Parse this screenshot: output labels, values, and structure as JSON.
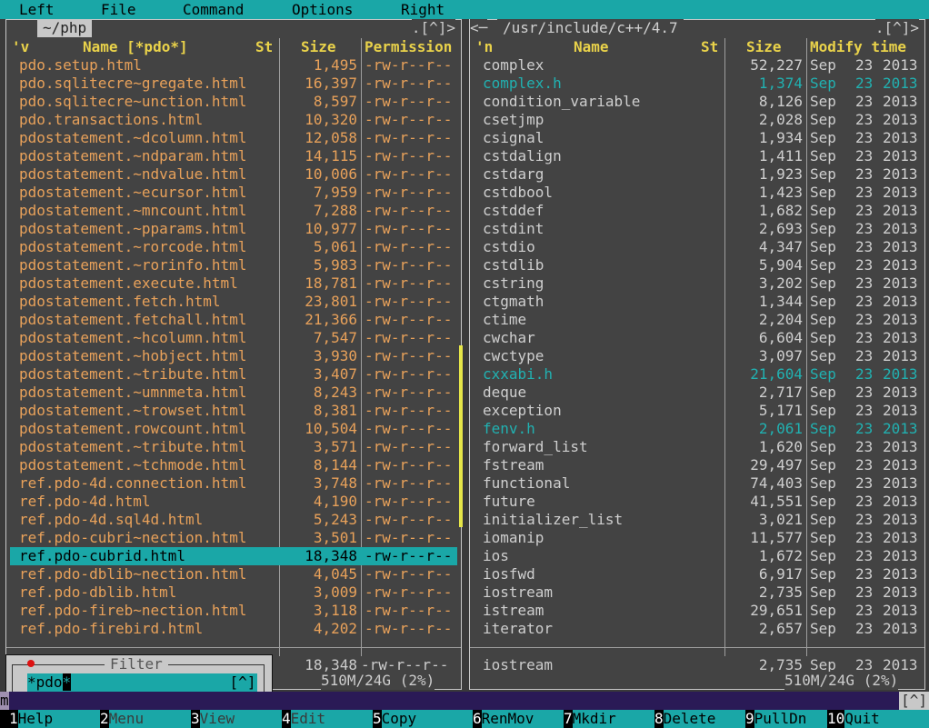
{
  "menubar": {
    "items": [
      "Left",
      "File",
      "Command",
      "Options",
      "Right"
    ]
  },
  "left_panel": {
    "title": "~/php",
    "corner": ".[^]>",
    "headers": {
      "sort": "'v",
      "name": "Name [*pdo*]",
      "st": "St",
      "size": "Size",
      "perm": "Permission"
    },
    "files": [
      {
        "name": "pdo.setup.html",
        "size": "1,495",
        "perm": "-rw-r--r--"
      },
      {
        "name": "pdo.sqlitecre~gregate.html",
        "size": "16,397",
        "perm": "-rw-r--r--"
      },
      {
        "name": "pdo.sqlitecre~unction.html",
        "size": "8,597",
        "perm": "-rw-r--r--"
      },
      {
        "name": "pdo.transactions.html",
        "size": "10,320",
        "perm": "-rw-r--r--"
      },
      {
        "name": "pdostatement.~dcolumn.html",
        "size": "12,058",
        "perm": "-rw-r--r--"
      },
      {
        "name": "pdostatement.~ndparam.html",
        "size": "14,115",
        "perm": "-rw-r--r--"
      },
      {
        "name": "pdostatement.~ndvalue.html",
        "size": "10,006",
        "perm": "-rw-r--r--"
      },
      {
        "name": "pdostatement.~ecursor.html",
        "size": "7,959",
        "perm": "-rw-r--r--"
      },
      {
        "name": "pdostatement.~mncount.html",
        "size": "7,288",
        "perm": "-rw-r--r--"
      },
      {
        "name": "pdostatement.~pparams.html",
        "size": "10,977",
        "perm": "-rw-r--r--"
      },
      {
        "name": "pdostatement.~rorcode.html",
        "size": "5,061",
        "perm": "-rw-r--r--"
      },
      {
        "name": "pdostatement.~rorinfo.html",
        "size": "5,983",
        "perm": "-rw-r--r--"
      },
      {
        "name": "pdostatement.execute.html",
        "size": "18,781",
        "perm": "-rw-r--r--"
      },
      {
        "name": "pdostatement.fetch.html",
        "size": "23,801",
        "perm": "-rw-r--r--"
      },
      {
        "name": "pdostatement.fetchall.html",
        "size": "21,366",
        "perm": "-rw-r--r--"
      },
      {
        "name": "pdostatement.~hcolumn.html",
        "size": "7,547",
        "perm": "-rw-r--r--"
      },
      {
        "name": "pdostatement.~hobject.html",
        "size": "3,930",
        "perm": "-rw-r--r--"
      },
      {
        "name": "pdostatement.~tribute.html",
        "size": "3,407",
        "perm": "-rw-r--r--"
      },
      {
        "name": "pdostatement.~umnmeta.html",
        "size": "8,243",
        "perm": "-rw-r--r--"
      },
      {
        "name": "pdostatement.~trowset.html",
        "size": "8,381",
        "perm": "-rw-r--r--"
      },
      {
        "name": "pdostatement.rowcount.html",
        "size": "10,504",
        "perm": "-rw-r--r--"
      },
      {
        "name": "pdostatement.~tribute.html",
        "size": "3,571",
        "perm": "-rw-r--r--"
      },
      {
        "name": "pdostatement.~tchmode.html",
        "size": "8,144",
        "perm": "-rw-r--r--"
      },
      {
        "name": "ref.pdo-4d.connection.html",
        "size": "3,748",
        "perm": "-rw-r--r--"
      },
      {
        "name": "ref.pdo-4d.html",
        "size": "4,190",
        "perm": "-rw-r--r--"
      },
      {
        "name": "ref.pdo-4d.sql4d.html",
        "size": "5,243",
        "perm": "-rw-r--r--"
      },
      {
        "name": "ref.pdo-cubri~nection.html",
        "size": "3,501",
        "perm": "-rw-r--r--"
      },
      {
        "name": "ref.pdo-cubrid.html",
        "size": "18,348",
        "perm": "-rw-r--r--",
        "cursor": true
      },
      {
        "name": "ref.pdo-dblib~nection.html",
        "size": "4,045",
        "perm": "-rw-r--r--"
      },
      {
        "name": "ref.pdo-dblib.html",
        "size": "3,009",
        "perm": "-rw-r--r--"
      },
      {
        "name": "ref.pdo-fireb~nection.html",
        "size": "3,118",
        "perm": "-rw-r--r--"
      },
      {
        "name": "ref.pdo-firebird.html",
        "size": "4,202",
        "perm": "-rw-r--r--"
      }
    ],
    "summary": {
      "size": "18,348",
      "perm": "-rw-r--r--"
    },
    "free": "510M/24G (2%)"
  },
  "right_panel": {
    "title": "/usr/include/c++/4.7",
    "corner": ".[^]>",
    "headers": {
      "sort": "'n",
      "name": "Name",
      "st": "St",
      "size": "Size",
      "mtime": "Modify time"
    },
    "files": [
      {
        "name": "complex",
        "size": "52,227",
        "month": "Sep",
        "day": "23",
        "year": "2013"
      },
      {
        "name": "complex.h",
        "size": "1,374",
        "month": "Sep",
        "day": "23",
        "year": "2013",
        "hl": true
      },
      {
        "name": "condition_variable",
        "size": "8,126",
        "month": "Sep",
        "day": "23",
        "year": "2013"
      },
      {
        "name": "csetjmp",
        "size": "2,028",
        "month": "Sep",
        "day": "23",
        "year": "2013"
      },
      {
        "name": "csignal",
        "size": "1,934",
        "month": "Sep",
        "day": "23",
        "year": "2013"
      },
      {
        "name": "cstdalign",
        "size": "1,411",
        "month": "Sep",
        "day": "23",
        "year": "2013"
      },
      {
        "name": "cstdarg",
        "size": "1,923",
        "month": "Sep",
        "day": "23",
        "year": "2013"
      },
      {
        "name": "cstdbool",
        "size": "1,423",
        "month": "Sep",
        "day": "23",
        "year": "2013"
      },
      {
        "name": "cstddef",
        "size": "1,682",
        "month": "Sep",
        "day": "23",
        "year": "2013"
      },
      {
        "name": "cstdint",
        "size": "2,693",
        "month": "Sep",
        "day": "23",
        "year": "2013"
      },
      {
        "name": "cstdio",
        "size": "4,347",
        "month": "Sep",
        "day": "23",
        "year": "2013"
      },
      {
        "name": "cstdlib",
        "size": "5,904",
        "month": "Sep",
        "day": "23",
        "year": "2013"
      },
      {
        "name": "cstring",
        "size": "3,202",
        "month": "Sep",
        "day": "23",
        "year": "2013"
      },
      {
        "name": "ctgmath",
        "size": "1,344",
        "month": "Sep",
        "day": "23",
        "year": "2013"
      },
      {
        "name": "ctime",
        "size": "2,204",
        "month": "Sep",
        "day": "23",
        "year": "2013"
      },
      {
        "name": "cwchar",
        "size": "6,604",
        "month": "Sep",
        "day": "23",
        "year": "2013"
      },
      {
        "name": "cwctype",
        "size": "3,097",
        "month": "Sep",
        "day": "23",
        "year": "2013"
      },
      {
        "name": "cxxabi.h",
        "size": "21,604",
        "month": "Sep",
        "day": "23",
        "year": "2013",
        "hl": true
      },
      {
        "name": "deque",
        "size": "2,717",
        "month": "Sep",
        "day": "23",
        "year": "2013"
      },
      {
        "name": "exception",
        "size": "5,171",
        "month": "Sep",
        "day": "23",
        "year": "2013"
      },
      {
        "name": "fenv.h",
        "size": "2,061",
        "month": "Sep",
        "day": "23",
        "year": "2013",
        "hl": true
      },
      {
        "name": "forward_list",
        "size": "1,620",
        "month": "Sep",
        "day": "23",
        "year": "2013"
      },
      {
        "name": "fstream",
        "size": "29,497",
        "month": "Sep",
        "day": "23",
        "year": "2013"
      },
      {
        "name": "functional",
        "size": "74,403",
        "month": "Sep",
        "day": "23",
        "year": "2013"
      },
      {
        "name": "future",
        "size": "41,551",
        "month": "Sep",
        "day": "23",
        "year": "2013"
      },
      {
        "name": "initializer_list",
        "size": "3,021",
        "month": "Sep",
        "day": "23",
        "year": "2013"
      },
      {
        "name": "iomanip",
        "size": "11,577",
        "month": "Sep",
        "day": "23",
        "year": "2013"
      },
      {
        "name": "ios",
        "size": "1,672",
        "month": "Sep",
        "day": "23",
        "year": "2013"
      },
      {
        "name": "iosfwd",
        "size": "6,917",
        "month": "Sep",
        "day": "23",
        "year": "2013"
      },
      {
        "name": "iostream",
        "size": "2,735",
        "month": "Sep",
        "day": "23",
        "year": "2013"
      },
      {
        "name": "istream",
        "size": "29,651",
        "month": "Sep",
        "day": "23",
        "year": "2013"
      },
      {
        "name": "iterator",
        "size": "2,657",
        "month": "Sep",
        "day": "23",
        "year": "2013"
      }
    ],
    "summary": {
      "name": "iostream",
      "size": "2,735",
      "month": "Sep",
      "day": "23",
      "year": "2013"
    },
    "free": "510M/24G (2%)"
  },
  "filter": {
    "label": "Filter",
    "value_prefix": "*pdo",
    "value_cursor": "*",
    "button": "[^]"
  },
  "cmdline": {
    "prompt": "m",
    "bracket": "[^]"
  },
  "fkeys": [
    {
      "num": "1",
      "label": "Help"
    },
    {
      "num": "2",
      "label": "Menu",
      "dim": true
    },
    {
      "num": "3",
      "label": "View",
      "dim": true
    },
    {
      "num": "4",
      "label": "Edit",
      "dim": true
    },
    {
      "num": "5",
      "label": "Copy"
    },
    {
      "num": "6",
      "label": "RenMov"
    },
    {
      "num": "7",
      "label": "Mkdir"
    },
    {
      "num": "8",
      "label": "Delete"
    },
    {
      "num": "9",
      "label": "PullDn"
    },
    {
      "num": "10",
      "label": "Quit"
    }
  ],
  "colors": {
    "accent": "#1aa7a7",
    "file_orange": "#e8a15a",
    "header_yellow": "#e9d24a",
    "highlight_cyan": "#21b1b1"
  }
}
